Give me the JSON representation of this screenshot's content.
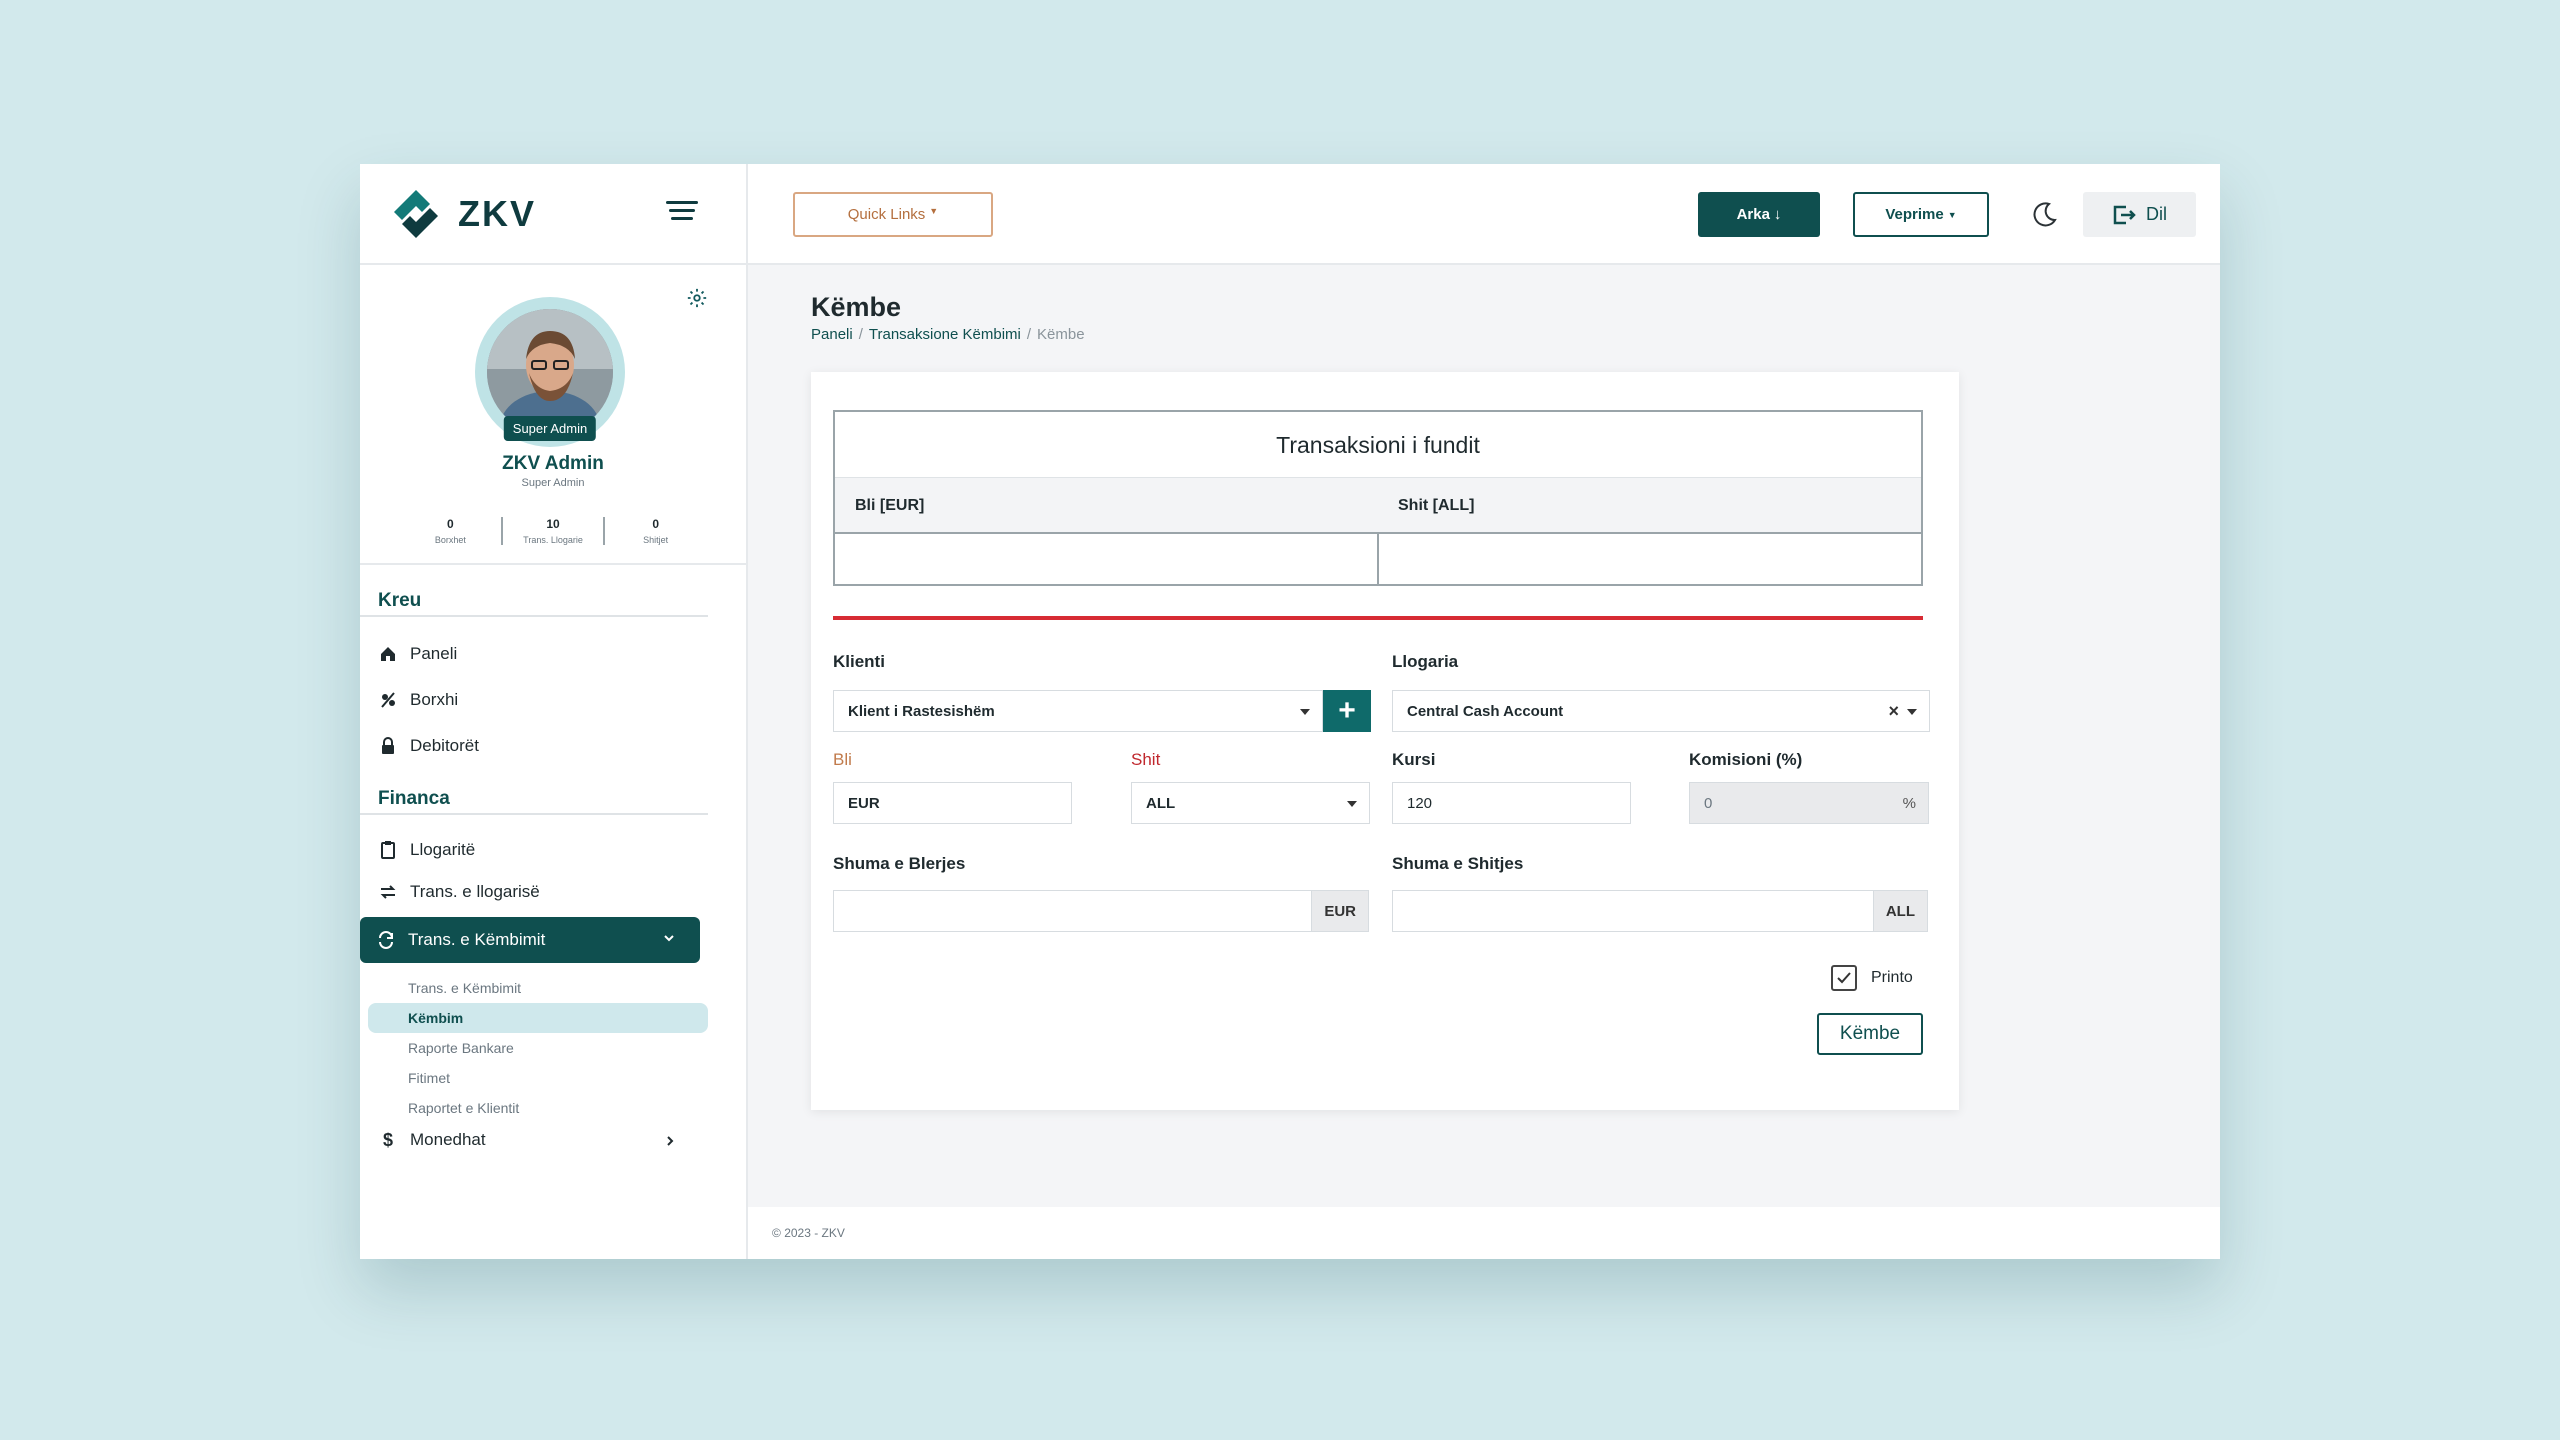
{
  "brand": {
    "name": "ZKV"
  },
  "profile": {
    "badge": "Super Admin",
    "name": "ZKV Admin",
    "role": "Super Admin",
    "stats": [
      {
        "value": "0",
        "label": "Borxhet"
      },
      {
        "value": "10",
        "label": "Trans. Llogarie"
      },
      {
        "value": "0",
        "label": "Shitjet"
      }
    ]
  },
  "sidebar": {
    "section1": "Kreu",
    "section2": "Financa",
    "items1": [
      {
        "label": "Paneli",
        "icon": "home-icon"
      },
      {
        "label": "Borxhi",
        "icon": "debt-icon"
      },
      {
        "label": "Debitorët",
        "icon": "lock-icon"
      }
    ],
    "items2": [
      {
        "label": "Llogaritë",
        "icon": "clipboard-icon"
      },
      {
        "label": "Trans. e llogarisë",
        "icon": "transfer-icon"
      }
    ],
    "active": "Trans. e Këmbimit",
    "sub": [
      "Trans. e Këmbimit",
      "Këmbim",
      "Raporte Bankare",
      "Fitimet",
      "Raportet e Klientit"
    ],
    "currencies": "Monedhat"
  },
  "topbar": {
    "quick_links": "Quick Links",
    "arka": "Arka",
    "veprime": "Veprime",
    "dil": "Dil"
  },
  "page": {
    "title": "Këmbe",
    "breadcrumb": [
      "Paneli",
      "Transaksione Këmbimi",
      "Këmbe"
    ]
  },
  "last_transaction": {
    "title": "Transaksioni i fundit",
    "buy_header": "Bli [EUR]",
    "sell_header": "Shit [ALL]"
  },
  "form": {
    "client_label": "Klienti",
    "client_value": "Klient i Rastesishëm",
    "account_label": "Llogaria",
    "account_value": "Central Cash Account",
    "buy_label": "Bli",
    "buy_value": "EUR",
    "sell_label": "Shit",
    "sell_value": "ALL",
    "rate_label": "Kursi",
    "rate_value": "120",
    "commission_label": "Komisioni (%)",
    "commission_value": "0",
    "commission_suffix": "%",
    "buy_amount_label": "Shuma e Blerjes",
    "buy_amount_suffix": "EUR",
    "sell_amount_label": "Shuma e Shitjes",
    "sell_amount_suffix": "ALL",
    "print_label": "Printo",
    "print_checked": true,
    "submit": "Këmbe"
  },
  "footer": {
    "text": "2023 - ZKV"
  },
  "colors": {
    "primary": "#0f4f4f",
    "accent": "#d72b34",
    "quick_links": "#b46f3e"
  }
}
